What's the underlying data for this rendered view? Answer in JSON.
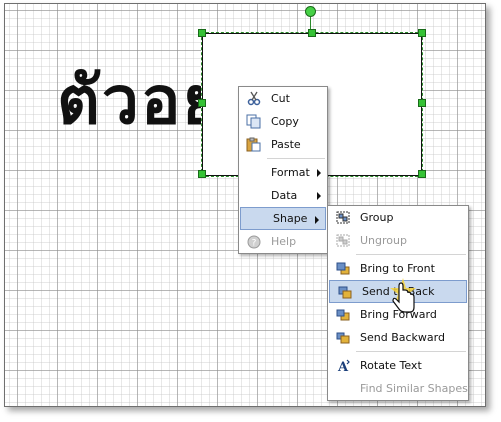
{
  "canvas": {
    "heading_text": "ตัวอย่"
  },
  "context_menu": {
    "items": [
      {
        "label": "Cut",
        "icon": "scissors-icon",
        "enabled": true
      },
      {
        "label": "Copy",
        "icon": "copy-icon",
        "enabled": true
      },
      {
        "label": "Paste",
        "icon": "paste-icon",
        "enabled": true
      },
      {
        "label": "Format",
        "icon": "",
        "enabled": true,
        "submenu": true
      },
      {
        "label": "Data",
        "icon": "",
        "enabled": true,
        "submenu": true
      },
      {
        "label": "Shape",
        "icon": "",
        "enabled": true,
        "submenu": true,
        "highlighted": true
      },
      {
        "label": "Help",
        "icon": "help-icon",
        "enabled": false
      }
    ]
  },
  "shape_submenu": {
    "items": [
      {
        "label": "Group",
        "icon": "group-icon",
        "enabled": true
      },
      {
        "label": "Ungroup",
        "icon": "ungroup-icon",
        "enabled": false
      },
      {
        "label": "Bring to Front",
        "icon": "bring-to-front-icon",
        "enabled": true
      },
      {
        "label": "Send to Back",
        "icon": "send-to-back-icon",
        "enabled": true,
        "highlighted": true
      },
      {
        "label": "Bring Forward",
        "icon": "bring-forward-icon",
        "enabled": true
      },
      {
        "label": "Send Backward",
        "icon": "send-backward-icon",
        "enabled": true
      },
      {
        "label": "Rotate Text",
        "icon": "rotate-text-icon",
        "enabled": true
      },
      {
        "label": "Find Similar Shapes",
        "icon": "",
        "enabled": false
      }
    ]
  },
  "colors": {
    "selection_handle": "#35c235",
    "menu_highlight": "#c9d9ee",
    "menu_highlight_border": "#7d9ccd"
  }
}
